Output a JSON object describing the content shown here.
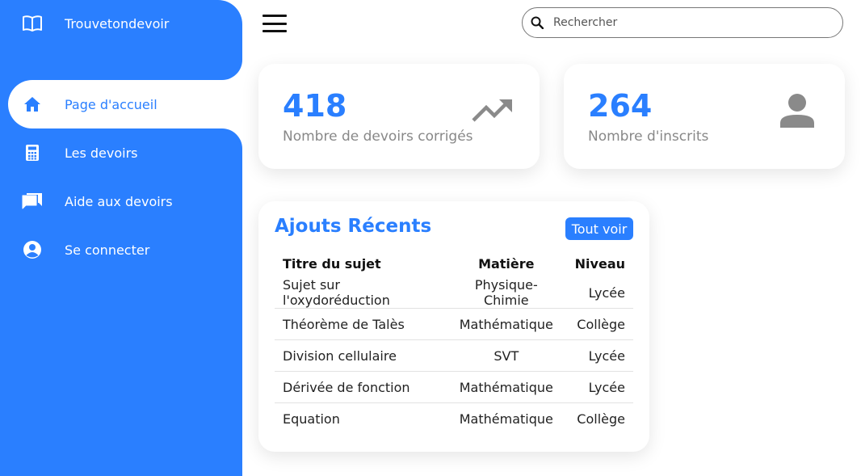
{
  "sidebar": {
    "brand": {
      "label": "Trouvetondevoir",
      "icon": "book-open-icon"
    },
    "items": [
      {
        "label": "Page d'accueil",
        "icon": "home-icon",
        "active": true
      },
      {
        "label": "Les devoirs",
        "icon": "calculator-icon",
        "active": false
      },
      {
        "label": "Aide aux devoirs",
        "icon": "forum-icon",
        "active": false
      },
      {
        "label": "Se connecter",
        "icon": "account-circle-icon",
        "active": false
      }
    ]
  },
  "topbar": {
    "menu_icon": "hamburger-menu-icon",
    "search": {
      "placeholder": "Rechercher",
      "icon": "search-icon"
    }
  },
  "stats": [
    {
      "value": "418",
      "label": "Nombre de devoirs corrigés",
      "icon": "trending-up-icon"
    },
    {
      "value": "264",
      "label": "Nombre d'inscrits",
      "icon": "person-icon"
    }
  ],
  "recent": {
    "title": "Ajouts Récents",
    "button_label": "Tout voir",
    "headers": [
      "Titre du sujet",
      "Matière",
      "Niveau"
    ],
    "rows": [
      [
        "Sujet sur l'oxydoréduction",
        "Physique-Chimie",
        "Lycée"
      ],
      [
        "Théorème de Talès",
        "Mathématique",
        "Collège"
      ],
      [
        "Division cellulaire",
        "SVT",
        "Lycée"
      ],
      [
        "Dérivée de fonction",
        "Mathématique",
        "Lycée"
      ],
      [
        "Equation",
        "Mathématique",
        "Collège"
      ]
    ]
  },
  "colors": {
    "accent": "#2a7fff",
    "muted": "#888888",
    "icon_gray": "#8a8a8a"
  }
}
